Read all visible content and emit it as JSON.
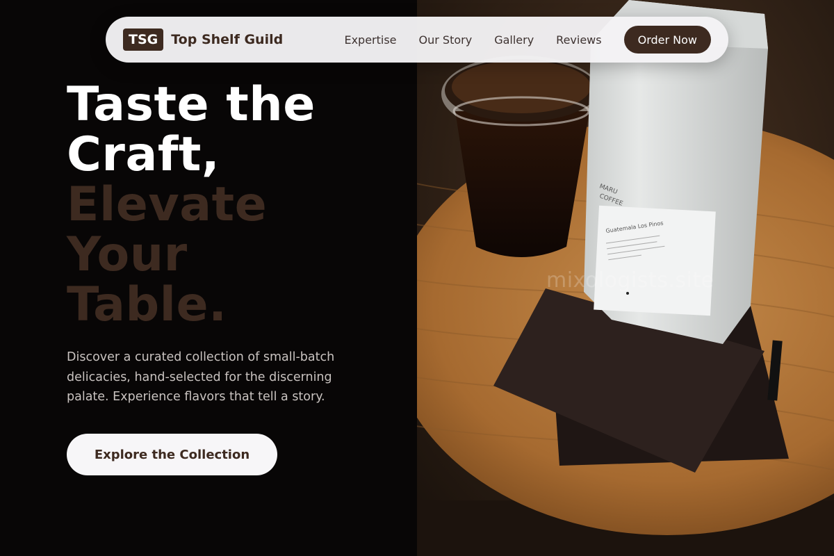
{
  "nav": {
    "brand_mark": "TSG",
    "brand_name": "Top Shelf Guild",
    "links": [
      "Expertise",
      "Our Story",
      "Gallery",
      "Reviews"
    ],
    "cta_label": "Order Now"
  },
  "hero": {
    "headline_light": [
      "Taste the",
      "Craft,"
    ],
    "headline_dark": [
      "Elevate",
      "Your",
      "Table."
    ],
    "subtext": "Discover a curated collection of small-batch delicacies, hand-selected for the discerning palate. Experience flavors that tell a story.",
    "cta_label": "Explore the Collection"
  },
  "image": {
    "watermark": "mixologists.site",
    "bag_brand": "MARU COFFEE",
    "bag_label_title": "Guatemala Los Pinos"
  },
  "colors": {
    "accent": "#3d2a20",
    "background": "#080606",
    "nav_background": "#f4f3f5",
    "text_muted": "#c9c3c0"
  }
}
